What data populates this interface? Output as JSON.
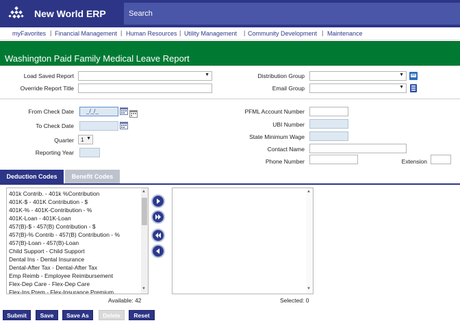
{
  "app": {
    "title": "New World ERP",
    "search_label": "Search"
  },
  "nav": [
    "myFavorites",
    "Financial Management",
    "Human Resources",
    "Utility Management",
    "Community Development",
    "Maintenance"
  ],
  "page": {
    "title": "Washington Paid Family Medical Leave Report"
  },
  "form": {
    "load_saved_report": "Load Saved Report",
    "override_report_title": "Override Report Title",
    "distribution_group": "Distribution Group",
    "email_group": "Email Group",
    "from_check_date": "From Check Date",
    "from_check_date_value": "_/_/_",
    "to_check_date": "To Check Date",
    "quarter": "Quarter",
    "quarter_value": "1",
    "reporting_year": "Reporting Year",
    "pfml_account_number": "PFML Account Number",
    "ubi_number": "UBI Number",
    "state_minimum_wage": "State Minimum Wage",
    "contact_name": "Contact Name",
    "phone_number": "Phone Number",
    "extension": "Extension"
  },
  "tabs": {
    "deduction_codes": "Deduction Codes",
    "benefit_codes": "Benefit Codes"
  },
  "available_items": [
    "401k Contrib. - 401k %Contribution",
    "401K-$ - 401K Contribution - $",
    "401K-% - 401K-Contribution - %",
    "401K-Loan - 401K-Loan",
    "457(B)-$ - 457(B) Contribution - $",
    "457(B)-% Contrib - 457(B) Contribution - %",
    "457(B)-Loan - 457(B)-Loan",
    "Child Support - Child Support",
    "Dental Ins - Dental Insurance",
    "Dental-After Tax - Dental-After Tax",
    "Emp Reimb - Employee Reimbursement",
    "Flex-Dep Care - Flex-Dep Care",
    "Flex-Ins Prem - Flex-Insurance Premium"
  ],
  "counts": {
    "available": "Available: 42",
    "selected": "Selected: 0"
  },
  "buttons": {
    "submit": "Submit",
    "save": "Save",
    "save_as": "Save As",
    "delete": "Delete",
    "reset": "Reset"
  },
  "colors": {
    "header": "#2d3586",
    "title_bar": "#007a33",
    "search": "#4a56a8",
    "field_blue": "#dde8f2"
  }
}
